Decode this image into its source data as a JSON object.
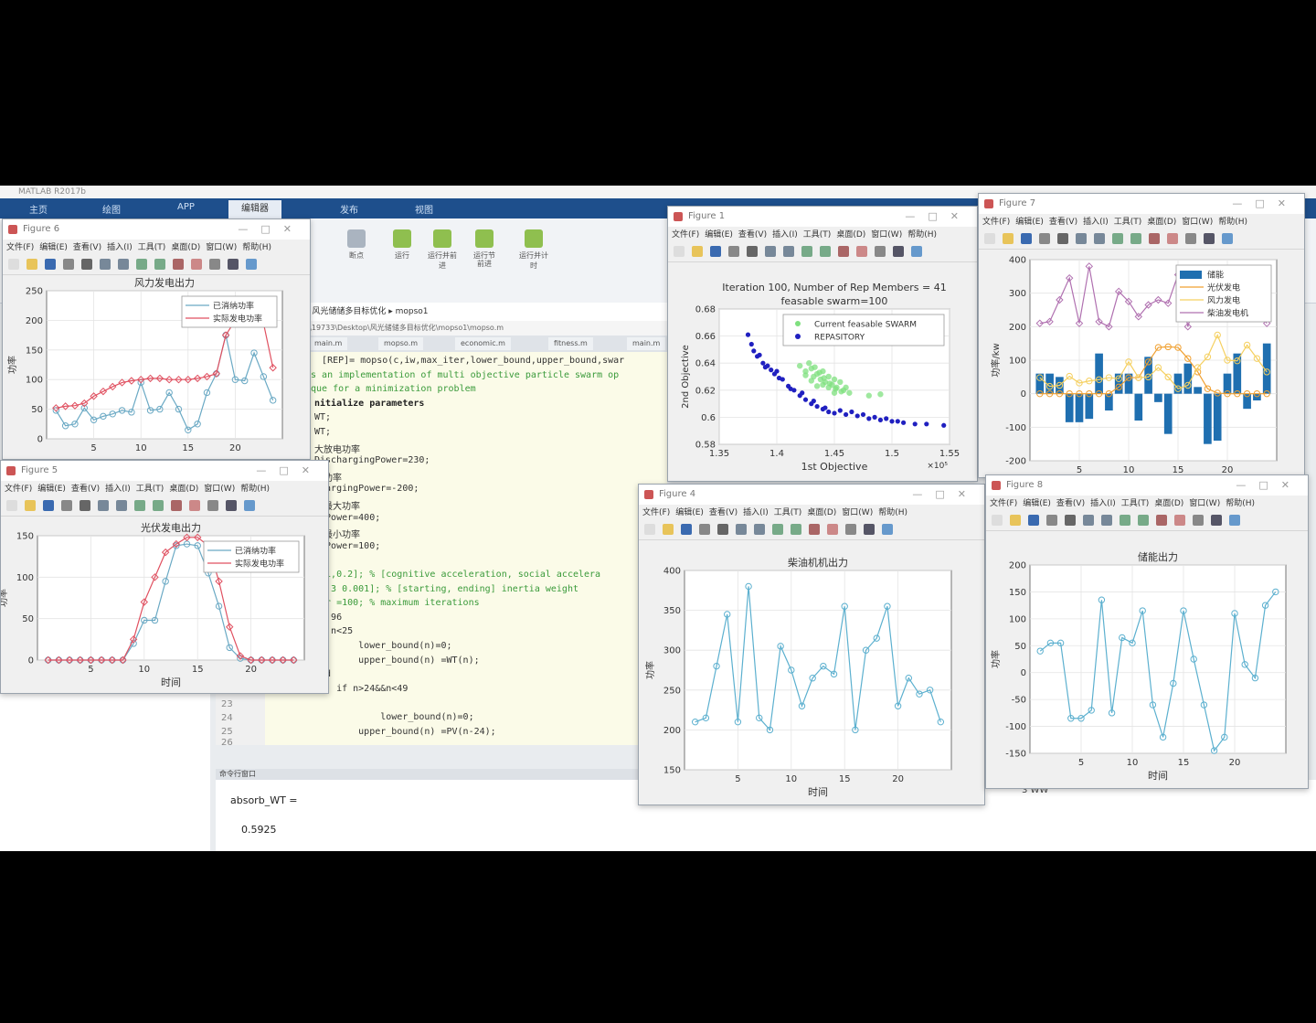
{
  "matlab": {
    "title": "MATLAB R2017b",
    "tabs": [
      "主页",
      "绘图",
      "APP",
      "编辑器",
      "发布",
      "视图"
    ],
    "ribbon_buttons": [
      "断点",
      "运行",
      "运行并前进",
      "运行节",
      "前进",
      "运行并计时"
    ],
    "address": "▸ 风光储储多目标优化 ▸ mopso1",
    "path": "s\\19733\\Desktop\\风光储储多目标优化\\mopso1\\mopso.m",
    "file_tabs": [
      "main.m",
      "mopso.m",
      "economic.m",
      "fitness.m",
      "main.m"
    ],
    "code_lines": [
      "n  [REP]= mopso(c,iw,max_iter,lower_bound,upper_bound,swar",
      "is an implementation of multi objective particle swarm op",
      "ique for a minimization problem",
      "nitialize parameters",
      "WT;",
      "WT;",
      "大放电功率",
      "DischargingPower=230;",
      "电功率",
      "ChargingPower=-200;",
      "机最大功率",
      "rtPower=400;",
      "机最小功率",
      "rtPower=100;",
      "=0",
      "0.1,0.2]; % [cognitive acceleration, social accelera",
      "[0.3 0.001]; % [starting, ending] inertia weight",
      "ter =100; % maximum iterations",
      "=1:96",
      "if n<25",
      "        lower_bound(n)=0;",
      "        upper_bound(n) =WT(n);",
      "end",
      "    if n>24&&n<49",
      "",
      "            lower_bound(n)=0;",
      "        upper_bound(n) =PV(n-24);"
    ],
    "line_numbers": [
      "23",
      "24",
      "25",
      "26",
      "27"
    ],
    "cmd_title": "命令行窗口",
    "cmd_lines": [
      "absorb_WT =",
      "0.5925"
    ],
    "right_label": "3 WW"
  },
  "figure_menu": [
    "文件(F)",
    "编辑(E)",
    "查看(V)",
    "插入(I)",
    "工具(T)",
    "桌面(D)",
    "窗口(W)",
    "帮助(H)"
  ],
  "figures": {
    "f6": {
      "window_title": "Figure 6",
      "chart_data": {
        "type": "line",
        "title": "风力发电出力",
        "ylabel": "功率",
        "xlim": [
          0,
          25
        ],
        "ylim": [
          0,
          250
        ],
        "xticks": [
          5,
          10,
          15,
          20
        ],
        "yticks": [
          0,
          50,
          100,
          150,
          200,
          250
        ],
        "legend": "top-right",
        "series": [
          {
            "name": "已消纳功率",
            "color": "#6aa9c4",
            "marker": "circle",
            "x": [
              1,
              2,
              3,
              4,
              5,
              6,
              7,
              8,
              9,
              10,
              11,
              12,
              13,
              14,
              15,
              16,
              17,
              18,
              19,
              20,
              21,
              22,
              23,
              24
            ],
            "values": [
              48,
              22,
              25,
              52,
              32,
              38,
              42,
              48,
              45,
              95,
              48,
              50,
              78,
              50,
              15,
              25,
              78,
              110,
              175,
              100,
              98,
              145,
              105,
              65
            ]
          },
          {
            "name": "实际发电功率",
            "color": "#e05060",
            "marker": "diamond",
            "x": [
              1,
              2,
              3,
              4,
              5,
              6,
              7,
              8,
              9,
              10,
              11,
              12,
              13,
              14,
              15,
              16,
              17,
              18,
              19,
              20,
              21,
              22,
              23,
              24
            ],
            "values": [
              52,
              55,
              56,
              60,
              72,
              80,
              88,
              95,
              98,
              100,
              102,
              102,
              100,
              100,
              100,
              102,
              105,
              110,
              175,
              200,
              205,
              210,
              195,
              120
            ]
          }
        ]
      }
    },
    "f5": {
      "window_title": "Figure 5",
      "chart_data": {
        "type": "line",
        "title": "光伏发电出力",
        "ylabel": "功率",
        "xlabel": "时间",
        "xlim": [
          0,
          25
        ],
        "ylim": [
          0,
          150
        ],
        "xticks": [
          5,
          10,
          15,
          20
        ],
        "yticks": [
          0,
          50,
          100,
          150
        ],
        "legend": "top-right",
        "series": [
          {
            "name": "已消纳功率",
            "color": "#6aa9c4",
            "marker": "circle",
            "x": [
              1,
              2,
              3,
              4,
              5,
              6,
              7,
              8,
              9,
              10,
              11,
              12,
              13,
              14,
              15,
              16,
              17,
              18,
              19,
              20,
              21,
              22,
              23,
              24
            ],
            "values": [
              0,
              0,
              0,
              0,
              0,
              0,
              0,
              0,
              20,
              48,
              48,
              95,
              138,
              140,
              138,
              105,
              65,
              15,
              2,
              0,
              0,
              0,
              0,
              0
            ]
          },
          {
            "name": "实际发电功率",
            "color": "#e05060",
            "marker": "diamond",
            "x": [
              1,
              2,
              3,
              4,
              5,
              6,
              7,
              8,
              9,
              10,
              11,
              12,
              13,
              14,
              15,
              16,
              17,
              18,
              19,
              20,
              21,
              22,
              23,
              24
            ],
            "values": [
              0,
              0,
              0,
              0,
              0,
              0,
              0,
              0,
              25,
              70,
              100,
              130,
              140,
              148,
              148,
              138,
              95,
              40,
              5,
              0,
              0,
              0,
              0,
              0
            ]
          }
        ]
      }
    },
    "f1": {
      "window_title": "Figure 1",
      "chart_data": {
        "type": "scatter",
        "title": "Iteration 100, Number of Rep Members = 41",
        "subtitle": "feasable swarm=100",
        "xlabel": "1st Objective",
        "ylabel": "2nd Objective",
        "x_multiplier": "×10⁵",
        "xlim": [
          1.35,
          1.55
        ],
        "ylim": [
          0.58,
          0.68
        ],
        "xticks": [
          1.35,
          1.4,
          1.45,
          1.5,
          1.55
        ],
        "yticks": [
          0.58,
          0.6,
          0.62,
          0.64,
          0.66,
          0.68
        ],
        "legend": "top-right",
        "series": [
          {
            "name": "Current feasable SWARM",
            "color": "#7fe07f",
            "marker": "circle",
            "x": [
              1.42,
              1.425,
              1.43,
              1.432,
              1.435,
              1.438,
              1.44,
              1.442,
              1.445,
              1.448,
              1.45,
              1.452,
              1.455,
              1.458,
              1.46,
              1.463,
              1.428,
              1.433,
              1.437,
              1.441,
              1.446,
              1.451,
              1.456,
              1.44,
              1.445,
              1.45,
              1.48,
              1.49,
              1.425,
              1.43,
              1.435
            ],
            "values": [
              0.638,
              0.634,
              0.636,
              0.63,
              0.632,
              0.628,
              0.634,
              0.626,
              0.63,
              0.624,
              0.628,
              0.622,
              0.626,
              0.62,
              0.622,
              0.618,
              0.64,
              0.637,
              0.633,
              0.629,
              0.625,
              0.621,
              0.619,
              0.624,
              0.622,
              0.618,
              0.616,
              0.617,
              0.631,
              0.627,
              0.623
            ]
          },
          {
            "name": "REPASITORY",
            "color": "#2020c0",
            "marker": "star",
            "x": [
              1.375,
              1.378,
              1.38,
              1.385,
              1.388,
              1.392,
              1.395,
              1.398,
              1.4,
              1.405,
              1.41,
              1.415,
              1.42,
              1.425,
              1.43,
              1.435,
              1.44,
              1.445,
              1.45,
              1.46,
              1.47,
              1.48,
              1.49,
              1.5,
              1.51,
              1.52,
              1.545,
              1.383,
              1.39,
              1.402,
              1.412,
              1.422,
              1.432,
              1.442,
              1.455,
              1.465,
              1.475,
              1.485,
              1.495,
              1.505,
              1.53
            ],
            "values": [
              0.661,
              0.654,
              0.649,
              0.646,
              0.64,
              0.638,
              0.635,
              0.632,
              0.634,
              0.628,
              0.623,
              0.62,
              0.616,
              0.613,
              0.61,
              0.608,
              0.606,
              0.604,
              0.603,
              0.602,
              0.601,
              0.599,
              0.598,
              0.597,
              0.596,
              0.595,
              0.594,
              0.645,
              0.637,
              0.629,
              0.621,
              0.618,
              0.612,
              0.607,
              0.605,
              0.604,
              0.602,
              0.6,
              0.599,
              0.597,
              0.595
            ]
          }
        ]
      }
    },
    "f4": {
      "window_title": "Figure 4",
      "chart_data": {
        "type": "line",
        "title": "柴油机机出力",
        "ylabel": "功率",
        "xlabel": "时间",
        "xlim": [
          0,
          25
        ],
        "ylim": [
          150,
          400
        ],
        "xticks": [
          5,
          10,
          15,
          20
        ],
        "yticks": [
          150,
          200,
          250,
          300,
          350,
          400
        ],
        "series": [
          {
            "name": "",
            "color": "#5cb0cf",
            "marker": "circle",
            "x": [
              1,
              2,
              3,
              4,
              5,
              6,
              7,
              8,
              9,
              10,
              11,
              12,
              13,
              14,
              15,
              16,
              17,
              18,
              19,
              20,
              21,
              22,
              23,
              24
            ],
            "values": [
              210,
              215,
              280,
              345,
              210,
              380,
              215,
              200,
              305,
              275,
              230,
              265,
              280,
              270,
              355,
              200,
              300,
              315,
              355,
              230,
              265,
              245,
              250,
              210
            ]
          }
        ]
      }
    },
    "f7": {
      "window_title": "Figure 7",
      "chart_data": {
        "type": "bar",
        "ylabel": "功率/kw",
        "xlim": [
          0,
          25
        ],
        "ylim": [
          -200,
          400
        ],
        "xticks": [
          5,
          10,
          15,
          20
        ],
        "yticks": [
          -200,
          -100,
          0,
          100,
          200,
          300,
          400
        ],
        "legend": "top-right",
        "bars": {
          "name": "储能",
          "color": "#1f6fb0",
          "x": [
            1,
            2,
            3,
            4,
            5,
            6,
            7,
            8,
            9,
            10,
            11,
            12,
            13,
            14,
            15,
            16,
            17,
            18,
            19,
            20,
            21,
            22,
            23,
            24
          ],
          "values": [
            60,
            60,
            50,
            -85,
            -85,
            -75,
            120,
            -50,
            60,
            60,
            -80,
            110,
            -25,
            -120,
            60,
            90,
            20,
            -150,
            -140,
            60,
            120,
            -45,
            -20,
            150
          ]
        },
        "series": [
          {
            "name": "光伏发电",
            "color": "#f0a030",
            "marker": "circle",
            "x": [
              1,
              2,
              3,
              4,
              5,
              6,
              7,
              8,
              9,
              10,
              11,
              12,
              13,
              14,
              15,
              16,
              17,
              18,
              19,
              20,
              21,
              22,
              23,
              24
            ],
            "values": [
              0,
              0,
              0,
              0,
              0,
              0,
              0,
              0,
              20,
              48,
              48,
              95,
              138,
              140,
              138,
              105,
              65,
              15,
              2,
              0,
              0,
              0,
              0,
              0
            ]
          },
          {
            "name": "风力发电",
            "color": "#f5d060",
            "marker": "circle",
            "x": [
              1,
              2,
              3,
              4,
              5,
              6,
              7,
              8,
              9,
              10,
              11,
              12,
              13,
              14,
              15,
              16,
              17,
              18,
              19,
              20,
              21,
              22,
              23,
              24
            ],
            "values": [
              48,
              22,
              25,
              52,
              32,
              38,
              42,
              48,
              45,
              95,
              48,
              50,
              78,
              50,
              15,
              25,
              78,
              110,
              175,
              100,
              98,
              145,
              105,
              65
            ]
          },
          {
            "name": "柴油发电机",
            "color": "#b070b0",
            "marker": "diamond",
            "x": [
              1,
              2,
              3,
              4,
              5,
              6,
              7,
              8,
              9,
              10,
              11,
              12,
              13,
              14,
              15,
              16,
              17,
              18,
              19,
              20,
              21,
              22,
              23,
              24
            ],
            "values": [
              210,
              215,
              280,
              345,
              210,
              380,
              215,
              200,
              305,
              275,
              230,
              265,
              280,
              270,
              355,
              200,
              300,
              315,
              355,
              230,
              265,
              245,
              250,
              210
            ]
          }
        ]
      }
    },
    "f8": {
      "window_title": "Figure 8",
      "chart_data": {
        "type": "line",
        "title": "储能出力",
        "ylabel": "功率",
        "xlabel": "时间",
        "xlim": [
          0,
          25
        ],
        "ylim": [
          -150,
          200
        ],
        "xticks": [
          5,
          10,
          15,
          20
        ],
        "yticks": [
          -150,
          -100,
          -50,
          0,
          50,
          100,
          150,
          200
        ],
        "series": [
          {
            "name": "",
            "color": "#5cb0cf",
            "marker": "circle",
            "x": [
              1,
              2,
              3,
              4,
              5,
              6,
              7,
              8,
              9,
              10,
              11,
              12,
              13,
              14,
              15,
              16,
              17,
              18,
              19,
              20,
              21,
              22,
              23,
              24
            ],
            "values": [
              40,
              55,
              55,
              -85,
              -85,
              -70,
              135,
              -75,
              65,
              55,
              115,
              -60,
              -120,
              -20,
              115,
              25,
              -60,
              -145,
              -120,
              110,
              15,
              -10,
              125,
              150
            ]
          }
        ]
      }
    }
  }
}
